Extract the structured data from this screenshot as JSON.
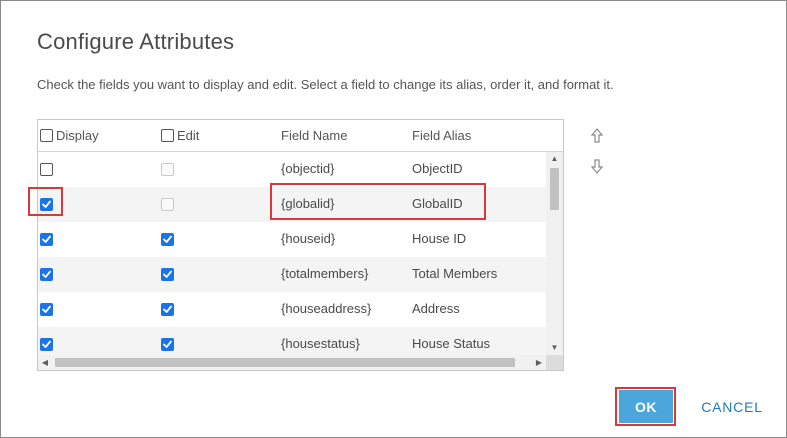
{
  "dialog": {
    "title": "Configure Attributes",
    "description": "Check the fields you want to display and edit. Select a field to change its alias, order it, and format it."
  },
  "table": {
    "headers": {
      "display": "Display",
      "edit": "Edit",
      "field_name": "Field Name",
      "field_alias": "Field Alias"
    },
    "rows": [
      {
        "display": false,
        "edit": false,
        "edit_enabled": false,
        "field_name": "{objectid}",
        "field_alias": "ObjectID"
      },
      {
        "display": true,
        "edit": false,
        "edit_enabled": false,
        "field_name": "{globalid}",
        "field_alias": "GlobalID"
      },
      {
        "display": true,
        "edit": true,
        "edit_enabled": true,
        "field_name": "{houseid}",
        "field_alias": "House ID"
      },
      {
        "display": true,
        "edit": true,
        "edit_enabled": true,
        "field_name": "{totalmembers}",
        "field_alias": "Total Members"
      },
      {
        "display": true,
        "edit": true,
        "edit_enabled": true,
        "field_name": "{houseaddress}",
        "field_alias": "Address"
      },
      {
        "display": true,
        "edit": true,
        "edit_enabled": true,
        "field_name": "{housestatus}",
        "field_alias": "House Status"
      }
    ]
  },
  "order_controls": {
    "move_up_icon": "arrow-up-icon",
    "move_down_icon": "arrow-down-icon"
  },
  "buttons": {
    "ok": "OK",
    "cancel": "CANCEL"
  },
  "colors": {
    "primary": "#4ba6dc",
    "checkbox_checked": "#1a73e8",
    "link": "#1f7bbf",
    "highlight": "#d9393b"
  }
}
